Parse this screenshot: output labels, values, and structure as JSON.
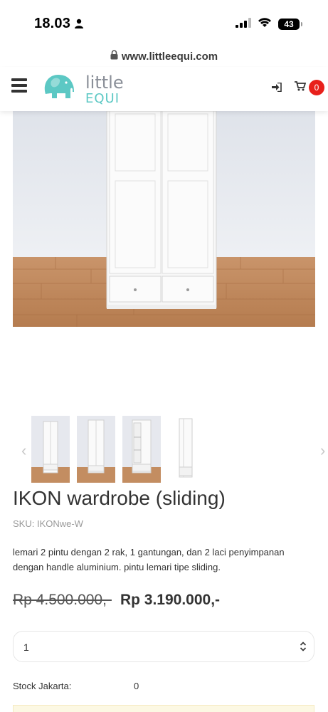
{
  "status_bar": {
    "time": "18.03",
    "battery": "43"
  },
  "browser": {
    "url": "www.littleequi.com"
  },
  "header": {
    "logo_line1": "little",
    "logo_line2": "EQUI",
    "cart_count": "0",
    "colors": {
      "logo_teal": "#5cc8c4",
      "logo_gray": "#8a8f98",
      "badge": "#e8201b"
    }
  },
  "product": {
    "title": "IKON wardrobe (sliding)",
    "sku": "SKU: IKONwe-W",
    "description": "lemari 2 pintu dengan 2 rak, 1 gantungan, dan 2 laci penyimpanan dengan handle aluminium. pintu lemari tipe sliding.",
    "price_old": "Rp 4.500.000,-",
    "price_new": "Rp 3.190.000,-",
    "quantity": "1",
    "stock_label": "Stock Jakarta:",
    "stock_value": "0"
  },
  "gallery": {
    "thumbnails": [
      "wardrobe-closed-front",
      "wardrobe-closed-angle",
      "wardrobe-open-shelves",
      "wardrobe-side-view"
    ]
  }
}
